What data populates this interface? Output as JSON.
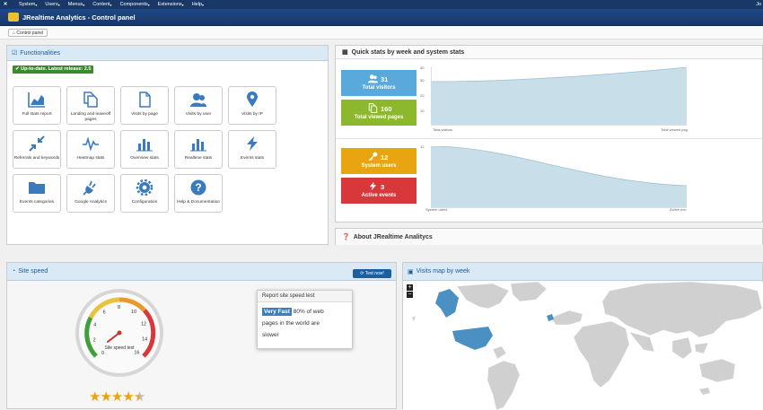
{
  "nav": {
    "menu": [
      "System",
      "Users",
      "Menus",
      "Content",
      "Components",
      "Extensions",
      "Help"
    ],
    "user": "Jo"
  },
  "header": {
    "title": "JRealtime Analytics - Control panel"
  },
  "toolbar": {
    "control_panel_label": "Control panel"
  },
  "functionalities": {
    "title": "Functionalities",
    "badge": "Up-to-date. Latest release: 2.5",
    "tiles": [
      {
        "label": "Full stats report",
        "icon": "chart-area-icon"
      },
      {
        "label": "Landing and leaveoff pages",
        "icon": "pages-icon"
      },
      {
        "label": "Visits by page",
        "icon": "page-icon"
      },
      {
        "label": "Visits by user",
        "icon": "users-icon"
      },
      {
        "label": "Visits by IP",
        "icon": "map-marker-icon"
      },
      {
        "label": "Referrals and keywords",
        "icon": "compress-arrows-icon"
      },
      {
        "label": "Heatmap stats",
        "icon": "pulse-icon"
      },
      {
        "label": "Overview stats",
        "icon": "bar-chart-icon"
      },
      {
        "label": "Realtime stats",
        "icon": "bar-chart-icon"
      },
      {
        "label": "Events stats",
        "icon": "lightning-icon"
      },
      {
        "label": "Events categories",
        "icon": "folder-icon"
      },
      {
        "label": "Google Analytics",
        "icon": "plug-icon"
      },
      {
        "label": "Configuration",
        "icon": "gear-icon"
      },
      {
        "label": "Help & Documentation",
        "icon": "question-icon"
      }
    ]
  },
  "quickstats": {
    "title": "Quick stats by week and system stats",
    "total_visitors": {
      "value": "31",
      "label": "Total visitors",
      "color": "#5aa9dc"
    },
    "total_viewed_pages": {
      "value": "160",
      "label": "Total viewed pages",
      "color": "#8cb82e"
    },
    "system_users": {
      "value": "12",
      "label": "System users",
      "color": "#e8a50f"
    },
    "active_events": {
      "value": "3",
      "label": "Active events",
      "color": "#d9383a"
    },
    "chart1": {
      "ylabels": [
        "40",
        "30",
        "20",
        "10"
      ],
      "xlabels": [
        "Total visitors",
        "Total viewed pag"
      ]
    },
    "chart2": {
      "ylabels": [
        "12"
      ],
      "xlabels": [
        "System users",
        "Active eve"
      ]
    }
  },
  "about": {
    "title": "About JRealtime Analitycs"
  },
  "sitespeed": {
    "title": "Site speed",
    "test_button": "Test now!",
    "gauge_label": "Site speed test",
    "gauge_numbers": [
      "0",
      "2",
      "4",
      "6",
      "8",
      "10",
      "12",
      "14",
      "16"
    ],
    "popover_title": "Report site speed test",
    "rating": "Very Fast",
    "text1": "80% of web",
    "text2": "pages in the world are",
    "text3": "slower",
    "stars": 4.5
  },
  "map": {
    "title": "Visits map by week",
    "zoom_in": "+",
    "zoom_out": "−"
  }
}
